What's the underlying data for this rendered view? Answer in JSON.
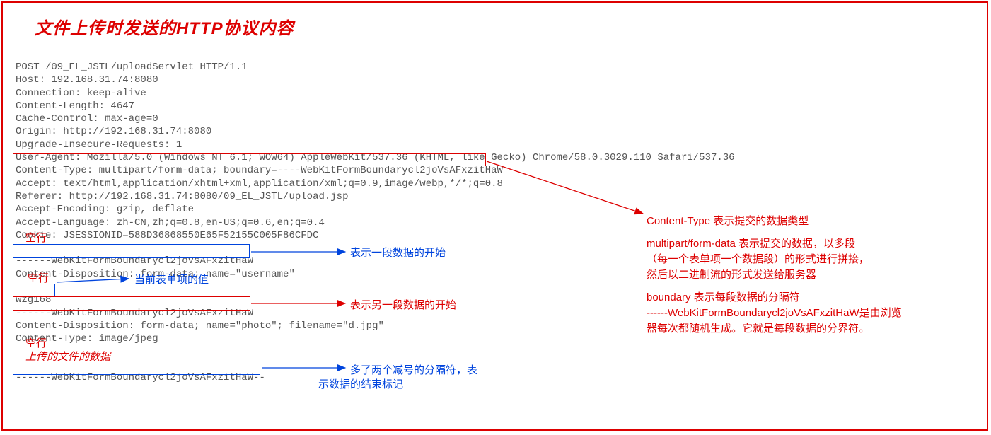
{
  "title": "文件上传时发送的HTTP协议内容",
  "http_lines": [
    "POST /09_EL_JSTL/uploadServlet HTTP/1.1",
    "Host: 192.168.31.74:8080",
    "Connection: keep-alive",
    "Content-Length: 4647",
    "Cache-Control: max-age=0",
    "Origin: http://192.168.31.74:8080",
    "Upgrade-Insecure-Requests: 1",
    "User-Agent: Mozilla/5.0 (Windows NT 6.1; WOW64) AppleWebKit/537.36 (KHTML, like Gecko) Chrome/58.0.3029.110 Safari/537.36",
    "Content-Type: multipart/form-data; boundary=----WebKitFormBoundarycl2joVsAFxzitHaW",
    "Accept: text/html,application/xhtml+xml,application/xml;q=0.9,image/webp,*/*;q=0.8",
    "Referer: http://192.168.31.74:8080/09_EL_JSTL/upload.jsp",
    "Accept-Encoding: gzip, deflate",
    "Accept-Language: zh-CN,zh;q=0.8,en-US;q=0.6,en;q=0.4",
    "Cookie: JSESSIONID=588D36868550E65F52155C005F86CFDC",
    "",
    "------WebKitFormBoundarycl2joVsAFxzitHaW",
    "Content-Disposition: form-data; name=\"username\"",
    "",
    "wzg168",
    "------WebKitFormBoundarycl2joVsAFxzitHaW",
    "Content-Disposition: form-data; name=\"photo\"; filename=\"d.jpg\"",
    "Content-Type: image/jpeg",
    "",
    "",
    "------WebKitFormBoundarycl2joVsAFxzitHaW--"
  ],
  "labels": {
    "blank1": "空行",
    "blank2": "空行",
    "blank3": "空行",
    "file_data": "上传的文件的数据",
    "form_value": "当前表单项的值",
    "start_seg": "表示一段数据的开始",
    "start_another": "表示另一段数据的开始",
    "end_marker_l1": "多了两个减号的分隔符，表",
    "end_marker_l2": "示数据的结束标记"
  },
  "right": {
    "ct": "Content-Type 表示提交的数据类型",
    "mp1": "multipart/form-data 表示提交的数据，以多段",
    "mp2": "（每一个表单项一个数据段）的形式进行拼接，",
    "mp3": "然后以二进制流的形式发送给服务器",
    "b1": "boundary 表示每段数据的分隔符",
    "b2": "------WebKitFormBoundarycl2joVsAFxzitHaW是由浏览",
    "b3": "器每次都随机生成。它就是每段数据的分界符。"
  }
}
